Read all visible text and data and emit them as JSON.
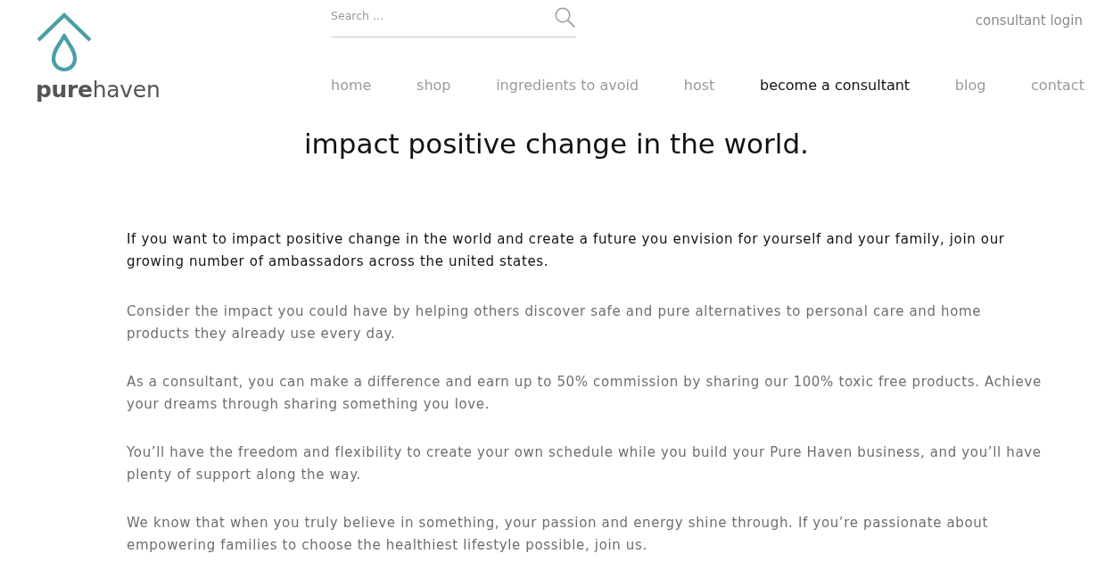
{
  "header": {
    "logo": {
      "text": "**pure**haven"
    },
    "search": {
      "placeholder": "Search …"
    },
    "consultant_login": "consultant login",
    "nav": [
      {
        "label": "home",
        "selected": false
      },
      {
        "label": "shop",
        "selected": false
      },
      {
        "label": "ingredients to avoid",
        "selected": false
      },
      {
        "label": "host",
        "selected": false
      },
      {
        "label": "become a consultant",
        "selected": true
      },
      {
        "label": "blog",
        "selected": false
      },
      {
        "label": "contact",
        "selected": false
      }
    ]
  },
  "main": {
    "heading": "impact positive change in the world.",
    "paragraphs": [
      {
        "kind": "lead",
        "lines": [
          "If you want to impact positive change in the world and create a future you envision for yourself and your family, join our",
          "growing number of ambassadors across the united states."
        ]
      },
      {
        "kind": "body",
        "lines": [
          "Consider the impact you could have by helping others discover safe and pure alternatives to personal care and home",
          "products they already use every day."
        ]
      },
      {
        "kind": "body",
        "lines": [
          "As a consultant, you can make a difference and earn up to 50% commission by sharing our 100% toxic free products. Achieve",
          "your dreams through sharing something you love."
        ]
      },
      {
        "kind": "body",
        "lines": [
          "You’ll have the freedom and flexibility to create your own schedule while you build your Pure Haven business, and you’ll have",
          "plenty of support along the way."
        ]
      },
      {
        "kind": "body",
        "lines": [
          "We know that when you truly believe in something, your passion and energy shine through. If you’re passionate about",
          "empowering families to choose the healthiest lifestyle possible, join us."
        ]
      }
    ]
  }
}
